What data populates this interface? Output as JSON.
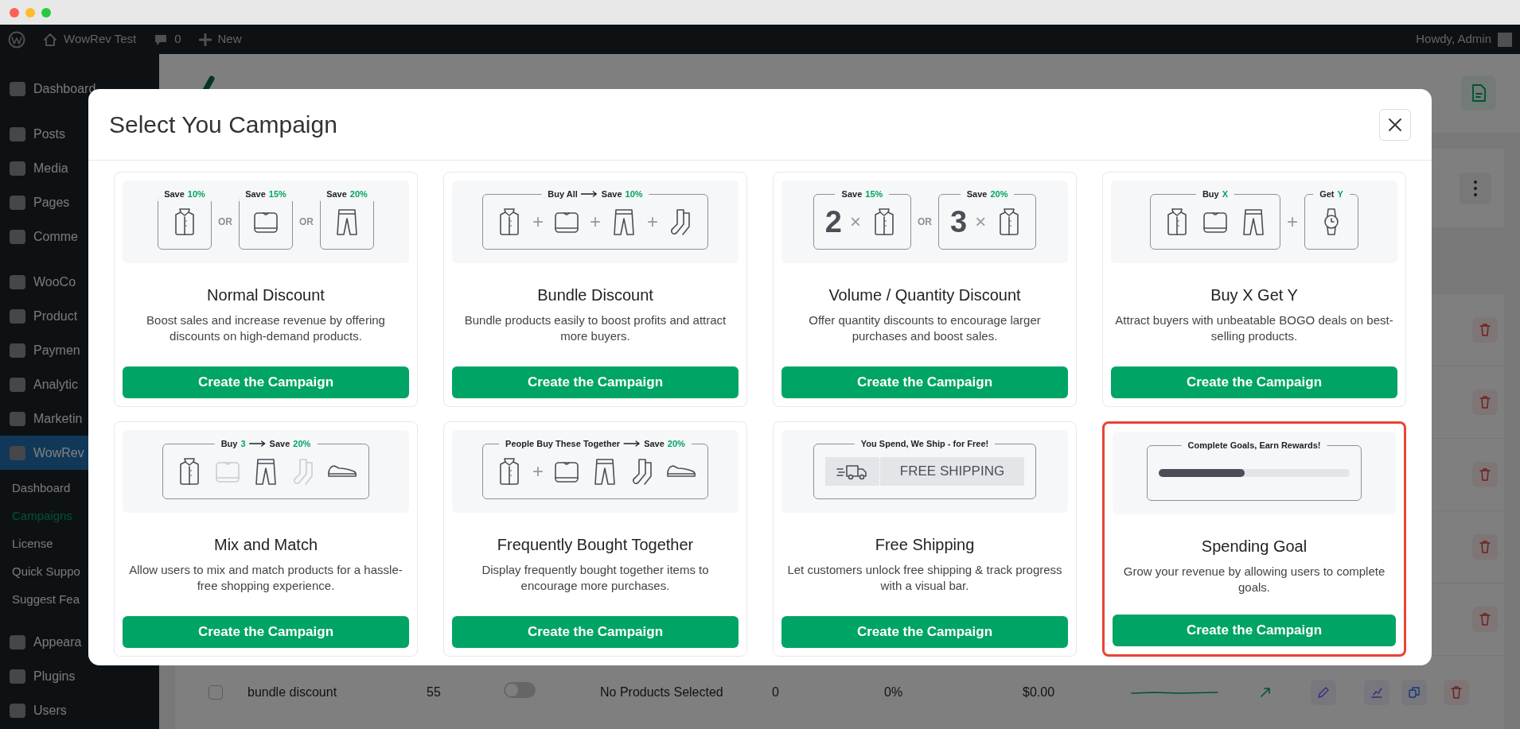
{
  "admin_bar": {
    "site": "WowRev Test",
    "comments": "0",
    "new": "New",
    "greeting": "Howdy, Admin"
  },
  "sidebar": {
    "items": [
      {
        "label": "Dashboard",
        "kind": "main",
        "selected": false
      },
      {
        "label": "Posts",
        "kind": "main",
        "selected": false
      },
      {
        "label": "Media",
        "kind": "main",
        "selected": false
      },
      {
        "label": "Pages",
        "kind": "main",
        "selected": false
      },
      {
        "label": "Comme",
        "kind": "main",
        "selected": false
      },
      {
        "label": "WooCo",
        "kind": "main",
        "selected": false
      },
      {
        "label": "Product",
        "kind": "main",
        "selected": false
      },
      {
        "label": "Paymen",
        "kind": "main",
        "selected": false
      },
      {
        "label": "Analytic",
        "kind": "main",
        "selected": false
      },
      {
        "label": "Marketin",
        "kind": "main",
        "selected": false
      },
      {
        "label": "WowRev",
        "kind": "main",
        "selected": true
      },
      {
        "label": "Dashboard",
        "kind": "sub",
        "selected": false
      },
      {
        "label": "Campaigns",
        "kind": "sub",
        "selected": true
      },
      {
        "label": "License",
        "kind": "sub",
        "selected": false
      },
      {
        "label": "Quick Suppo",
        "kind": "sub",
        "selected": false
      },
      {
        "label": "Suggest Fea",
        "kind": "sub",
        "selected": false
      },
      {
        "label": "Appeara",
        "kind": "main",
        "selected": false
      },
      {
        "label": "Plugins",
        "kind": "main",
        "selected": false
      },
      {
        "label": "Users",
        "kind": "main",
        "selected": false
      }
    ]
  },
  "table": {
    "row": {
      "checked": false,
      "name": "bundle discount",
      "count": "55",
      "enabled": false,
      "products": "No Products Selected",
      "orders": "0",
      "rate": "0%",
      "revenue": "$0.00"
    }
  },
  "modal": {
    "title": "Select You Campaign",
    "cards": [
      {
        "title": "Normal Discount",
        "description": "Boost sales and increase revenue by offering discounts on high-demand products.",
        "button": "Create the Campaign",
        "highlighted": false,
        "illustration": [
          {
            "kind": "frame",
            "label": [
              {
                "text": "Save"
              },
              {
                "text": "10%",
                "accent": true
              }
            ],
            "items": [
              {
                "kind": "shirt"
              }
            ]
          },
          {
            "kind": "join",
            "text": "OR"
          },
          {
            "kind": "frame",
            "label": [
              {
                "text": "Save"
              },
              {
                "text": "15%",
                "accent": true
              }
            ],
            "items": [
              {
                "kind": "sweater"
              }
            ]
          },
          {
            "kind": "join",
            "text": "OR"
          },
          {
            "kind": "frame",
            "label": [
              {
                "text": "Save"
              },
              {
                "text": "20%",
                "accent": true
              }
            ],
            "items": [
              {
                "kind": "pants"
              }
            ]
          }
        ]
      },
      {
        "title": "Bundle Discount",
        "description": "Bundle products easily to boost profits and attract more buyers.",
        "button": "Create the Campaign",
        "highlighted": false,
        "illustration": [
          {
            "kind": "frame",
            "label": [
              {
                "text": "Buy All"
              },
              {
                "kind": "arrow"
              },
              {
                "text": "Save"
              },
              {
                "text": "10%",
                "accent": true
              }
            ],
            "items": [
              {
                "kind": "shirt"
              },
              {
                "kind": "text",
                "text": "+"
              },
              {
                "kind": "sweater"
              },
              {
                "kind": "text",
                "text": "+"
              },
              {
                "kind": "pants"
              },
              {
                "kind": "text",
                "text": "+"
              },
              {
                "kind": "socks"
              }
            ]
          }
        ]
      },
      {
        "title": "Volume / Quantity Discount",
        "description": "Offer quantity discounts to encourage larger purchases and boost sales.",
        "button": "Create the Campaign",
        "highlighted": false,
        "illustration": [
          {
            "kind": "frame",
            "label": [
              {
                "text": "Save"
              },
              {
                "text": "15%",
                "accent": true
              }
            ],
            "items": [
              {
                "kind": "number",
                "text": "2"
              },
              {
                "kind": "text",
                "text": "×"
              },
              {
                "kind": "shirt"
              }
            ]
          },
          {
            "kind": "join",
            "text": "OR"
          },
          {
            "kind": "frame",
            "label": [
              {
                "text": "Save"
              },
              {
                "text": "20%",
                "accent": true
              }
            ],
            "items": [
              {
                "kind": "number",
                "text": "3"
              },
              {
                "kind": "text",
                "text": "×"
              },
              {
                "kind": "shirt"
              }
            ]
          }
        ]
      },
      {
        "title": "Buy X Get Y",
        "description": "Attract buyers with unbeatable BOGO deals on best-selling products.",
        "button": "Create the Campaign",
        "highlighted": false,
        "illustration": [
          {
            "kind": "frame",
            "label": [
              {
                "text": "Buy"
              },
              {
                "text": "X",
                "accent": true
              }
            ],
            "items": [
              {
                "kind": "shirt"
              },
              {
                "kind": "sweater"
              },
              {
                "kind": "pants"
              }
            ]
          },
          {
            "kind": "join",
            "text": "+"
          },
          {
            "kind": "frame",
            "label": [
              {
                "text": "Get"
              },
              {
                "text": "Y",
                "accent": true
              }
            ],
            "items": [
              {
                "kind": "watch"
              }
            ]
          }
        ]
      },
      {
        "title": "Mix and Match",
        "description": "Allow users to mix and match products for a hassle-free shopping experience.",
        "button": "Create the Campaign",
        "highlighted": false,
        "illustration": [
          {
            "kind": "frame",
            "label": [
              {
                "text": "Buy"
              },
              {
                "text": "3",
                "accent": true
              },
              {
                "kind": "arrow"
              },
              {
                "text": "Save"
              },
              {
                "text": "20%",
                "accent": true
              }
            ],
            "items": [
              {
                "kind": "shirt",
                "faded": false
              },
              {
                "kind": "sweater",
                "faded": true
              },
              {
                "kind": "pants",
                "faded": false
              },
              {
                "kind": "socks",
                "faded": true
              },
              {
                "kind": "shoe",
                "faded": false
              }
            ]
          }
        ]
      },
      {
        "title": "Frequently Bought Together",
        "description": "Display frequently bought together items to encourage more purchases.",
        "button": "Create the Campaign",
        "highlighted": false,
        "illustration": [
          {
            "kind": "frame",
            "label": [
              {
                "text": "People Buy These Together"
              },
              {
                "kind": "arrow"
              },
              {
                "text": "Save"
              },
              {
                "text": "20%",
                "accent": true
              }
            ],
            "items": [
              {
                "kind": "shirt"
              },
              {
                "kind": "text",
                "text": "+"
              },
              {
                "kind": "sweater"
              },
              {
                "kind": "pants"
              },
              {
                "kind": "socks"
              },
              {
                "kind": "shoe"
              }
            ]
          }
        ]
      },
      {
        "title": "Free Shipping",
        "description": "Let customers unlock free shipping & track progress with a visual bar.",
        "button": "Create the Campaign",
        "highlighted": false,
        "illustration": [
          {
            "kind": "frame",
            "label": [
              {
                "text": "You Spend, We Ship - for Free!"
              }
            ],
            "items": [
              {
                "kind": "shipbar",
                "text": "FREE SHIPPING"
              }
            ]
          }
        ]
      },
      {
        "title": "Spending Goal",
        "description": "Grow your revenue by allowing users to complete goals.",
        "button": "Create the Campaign",
        "highlighted": true,
        "illustration": [
          {
            "kind": "frame",
            "label": [
              {
                "text": "Complete Goals, Earn Rewards!"
              }
            ],
            "items": [
              {
                "kind": "progress",
                "level": 0.45
              }
            ]
          }
        ]
      }
    ]
  }
}
